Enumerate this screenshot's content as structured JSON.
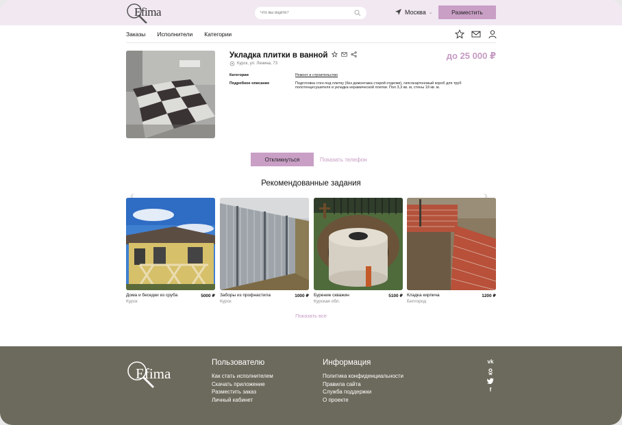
{
  "header": {
    "logo_text": "Efima",
    "search_placeholder": "Что вы ищете?",
    "city": "Москва",
    "post_button": "Разместить"
  },
  "nav": {
    "items": [
      "Заказы",
      "Исполнители",
      "Категории"
    ]
  },
  "task": {
    "title": "Укладка плитки в ванной",
    "address": "Курск, ул. Ленина, 73",
    "price": "до 25 000 ₽",
    "category_label": "Категории",
    "category_value": "Ремонт и строительство",
    "description_label": "Подробное описание",
    "description_value": "Подготовка стен под плитку (без демонтажа старой отделки), гипсокартоновый короб для труб полотенцесушителя и укладка керамической плитки. Пол 3,3 кв. м, стены 19 кв. м."
  },
  "actions": {
    "respond": "Откликнуться",
    "show_phone": "Показать телефон"
  },
  "recommended": {
    "title": "Рекомендованные задания",
    "cards": [
      {
        "name": "Дома и беседки из сруба",
        "price": "5000 ₽",
        "city": "Курск"
      },
      {
        "name": "Заборы из профнастила",
        "price": "1000 ₽",
        "city": "Курск"
      },
      {
        "name": "Бурение скважин",
        "price": "5100 ₽",
        "city": "Курская обл."
      },
      {
        "name": "Кладка кирпича",
        "price": "1200 ₽",
        "city": "Белгород"
      }
    ],
    "show_all": "Показать все"
  },
  "footer": {
    "logo_text": "Efima",
    "users_title": "Пользователю",
    "users_links": [
      "Как стать исполнителем",
      "Скачать приложение",
      "Разместить заказ",
      "Личный кабинет"
    ],
    "info_title": "Информация",
    "info_links": [
      "Политика конфиденциальности",
      "Правила сайта",
      "Служба поддержки",
      "О проекте"
    ],
    "social": [
      "vk-icon",
      "ok-icon",
      "twitter-icon",
      "facebook-icon"
    ]
  },
  "colors": {
    "accent": "#c99fc6",
    "accent_text": "#c59ac3",
    "header_bg": "#f1e8f1",
    "footer_bg": "#6c6a5c"
  }
}
